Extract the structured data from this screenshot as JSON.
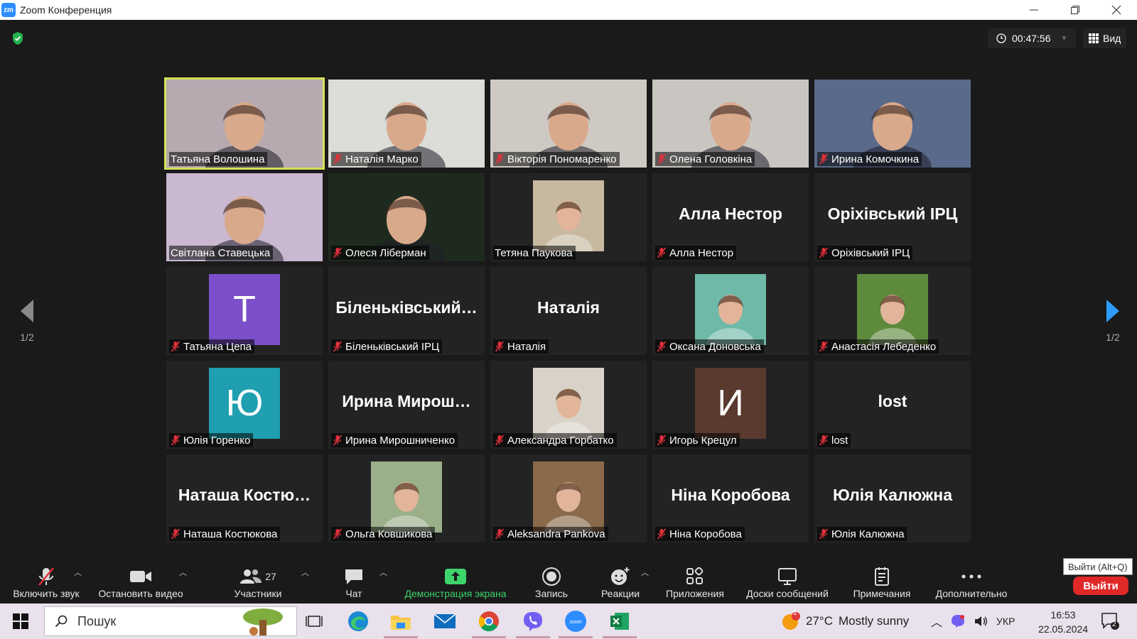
{
  "window": {
    "title": "Zoom Конференция",
    "logo": "zm"
  },
  "meeting": {
    "timer": "00:47:56",
    "view_label": "Вид",
    "page_indicator": "1/2",
    "tooltip": "Выйти (Alt+Q)",
    "leave_label": "Выйти"
  },
  "participants": [
    {
      "name": "Татьяна Волошина",
      "type": "video",
      "muted": false,
      "active": true,
      "bg": "#b7a9b0"
    },
    {
      "name": "Наталія Марко",
      "type": "video",
      "muted": true,
      "bg": "#dcdcd8"
    },
    {
      "name": "Вікторія Пономаренко",
      "type": "video",
      "muted": true,
      "bg": "#cfc9c3"
    },
    {
      "name": "Олена Головкіна",
      "type": "video",
      "muted": true,
      "bg": "#c9c6c1"
    },
    {
      "name": "Ирина Комочкина",
      "type": "video",
      "muted": true,
      "bg": "#5a6a8a"
    },
    {
      "name": "Світлана Ставецька",
      "type": "video",
      "muted": false,
      "bg": "#c9b8cf"
    },
    {
      "name": "Олеся Ліберман",
      "type": "video",
      "muted": true,
      "bg": "#1f2a1f"
    },
    {
      "name": "Тетяна Паукова",
      "type": "photo",
      "muted": false,
      "bg": "#c7b9a0"
    },
    {
      "name": "Алла Нестор",
      "type": "text",
      "display": "Алла Нестор",
      "muted": true
    },
    {
      "name": "Оріхівський ІРЦ",
      "type": "text",
      "display": "Оріхівський ІРЦ",
      "muted": true
    },
    {
      "name": "Татьяна Цепа",
      "type": "letter",
      "letter": "T",
      "color": "#7b4fc9",
      "muted": true
    },
    {
      "name": "Біленьківський ІРЦ",
      "type": "text",
      "display": "Біленьківський…",
      "muted": true
    },
    {
      "name": "Наталія",
      "type": "text",
      "display": "Наталія",
      "muted": true
    },
    {
      "name": "Оксана Доновська",
      "type": "photo",
      "muted": true,
      "bg": "#6fb9a9"
    },
    {
      "name": "Анастасія Лебеденко",
      "type": "photo",
      "muted": true,
      "bg": "#5e8a3e"
    },
    {
      "name": "Юлія Горенко",
      "type": "letter",
      "letter": "Ю",
      "color": "#1f9fb0",
      "muted": true
    },
    {
      "name": "Ирина Мирошниченко",
      "type": "text",
      "display": "Ирина  Мирош…",
      "muted": true
    },
    {
      "name": "Александра Горбатко",
      "type": "photo",
      "muted": true,
      "bg": "#d9d2c8"
    },
    {
      "name": "Игорь Крецул",
      "type": "letter",
      "letter": "И",
      "color": "#5a3a2e",
      "muted": true
    },
    {
      "name": "lost",
      "type": "text",
      "display": "lost",
      "muted": true
    },
    {
      "name": "Наташа Костюкова",
      "type": "text",
      "display": "Наташа  Костю…",
      "muted": true
    },
    {
      "name": "Ольга Ковшикова",
      "type": "photo",
      "muted": true,
      "bg": "#9ab08a"
    },
    {
      "name": "Aleksandra Pankova",
      "type": "photo",
      "muted": true,
      "bg": "#8a6a4a"
    },
    {
      "name": "Ніна Коробова",
      "type": "text",
      "display": "Ніна Коробова",
      "muted": true
    },
    {
      "name": "Юлія Калюжна",
      "type": "text",
      "display": "Юлія Калюжна",
      "muted": true
    }
  ],
  "toolbar": {
    "unmute": "Включить звук",
    "stop_video": "Остановить видео",
    "participants": "Участники",
    "participants_count": "27",
    "chat": "Чат",
    "share": "Демонстрация экрана",
    "record": "Запись",
    "reactions": "Реакции",
    "apps": "Приложения",
    "whiteboards": "Доски сообщений",
    "notes": "Примечания",
    "more": "Дополнительно"
  },
  "taskbar": {
    "search_placeholder": "Пошук",
    "weather_temp": "27°C",
    "weather_text": "Mostly sunny",
    "weather_badge": "1",
    "language": "УКР",
    "time": "16:53",
    "date": "22.05.2024",
    "notif_count": "2"
  },
  "colors": {
    "accent_green": "#3dd46b",
    "active_border": "#d4e157",
    "leave_red": "#e02828",
    "muted_red": "#e0303a",
    "nav_blue": "#2d9cff"
  }
}
